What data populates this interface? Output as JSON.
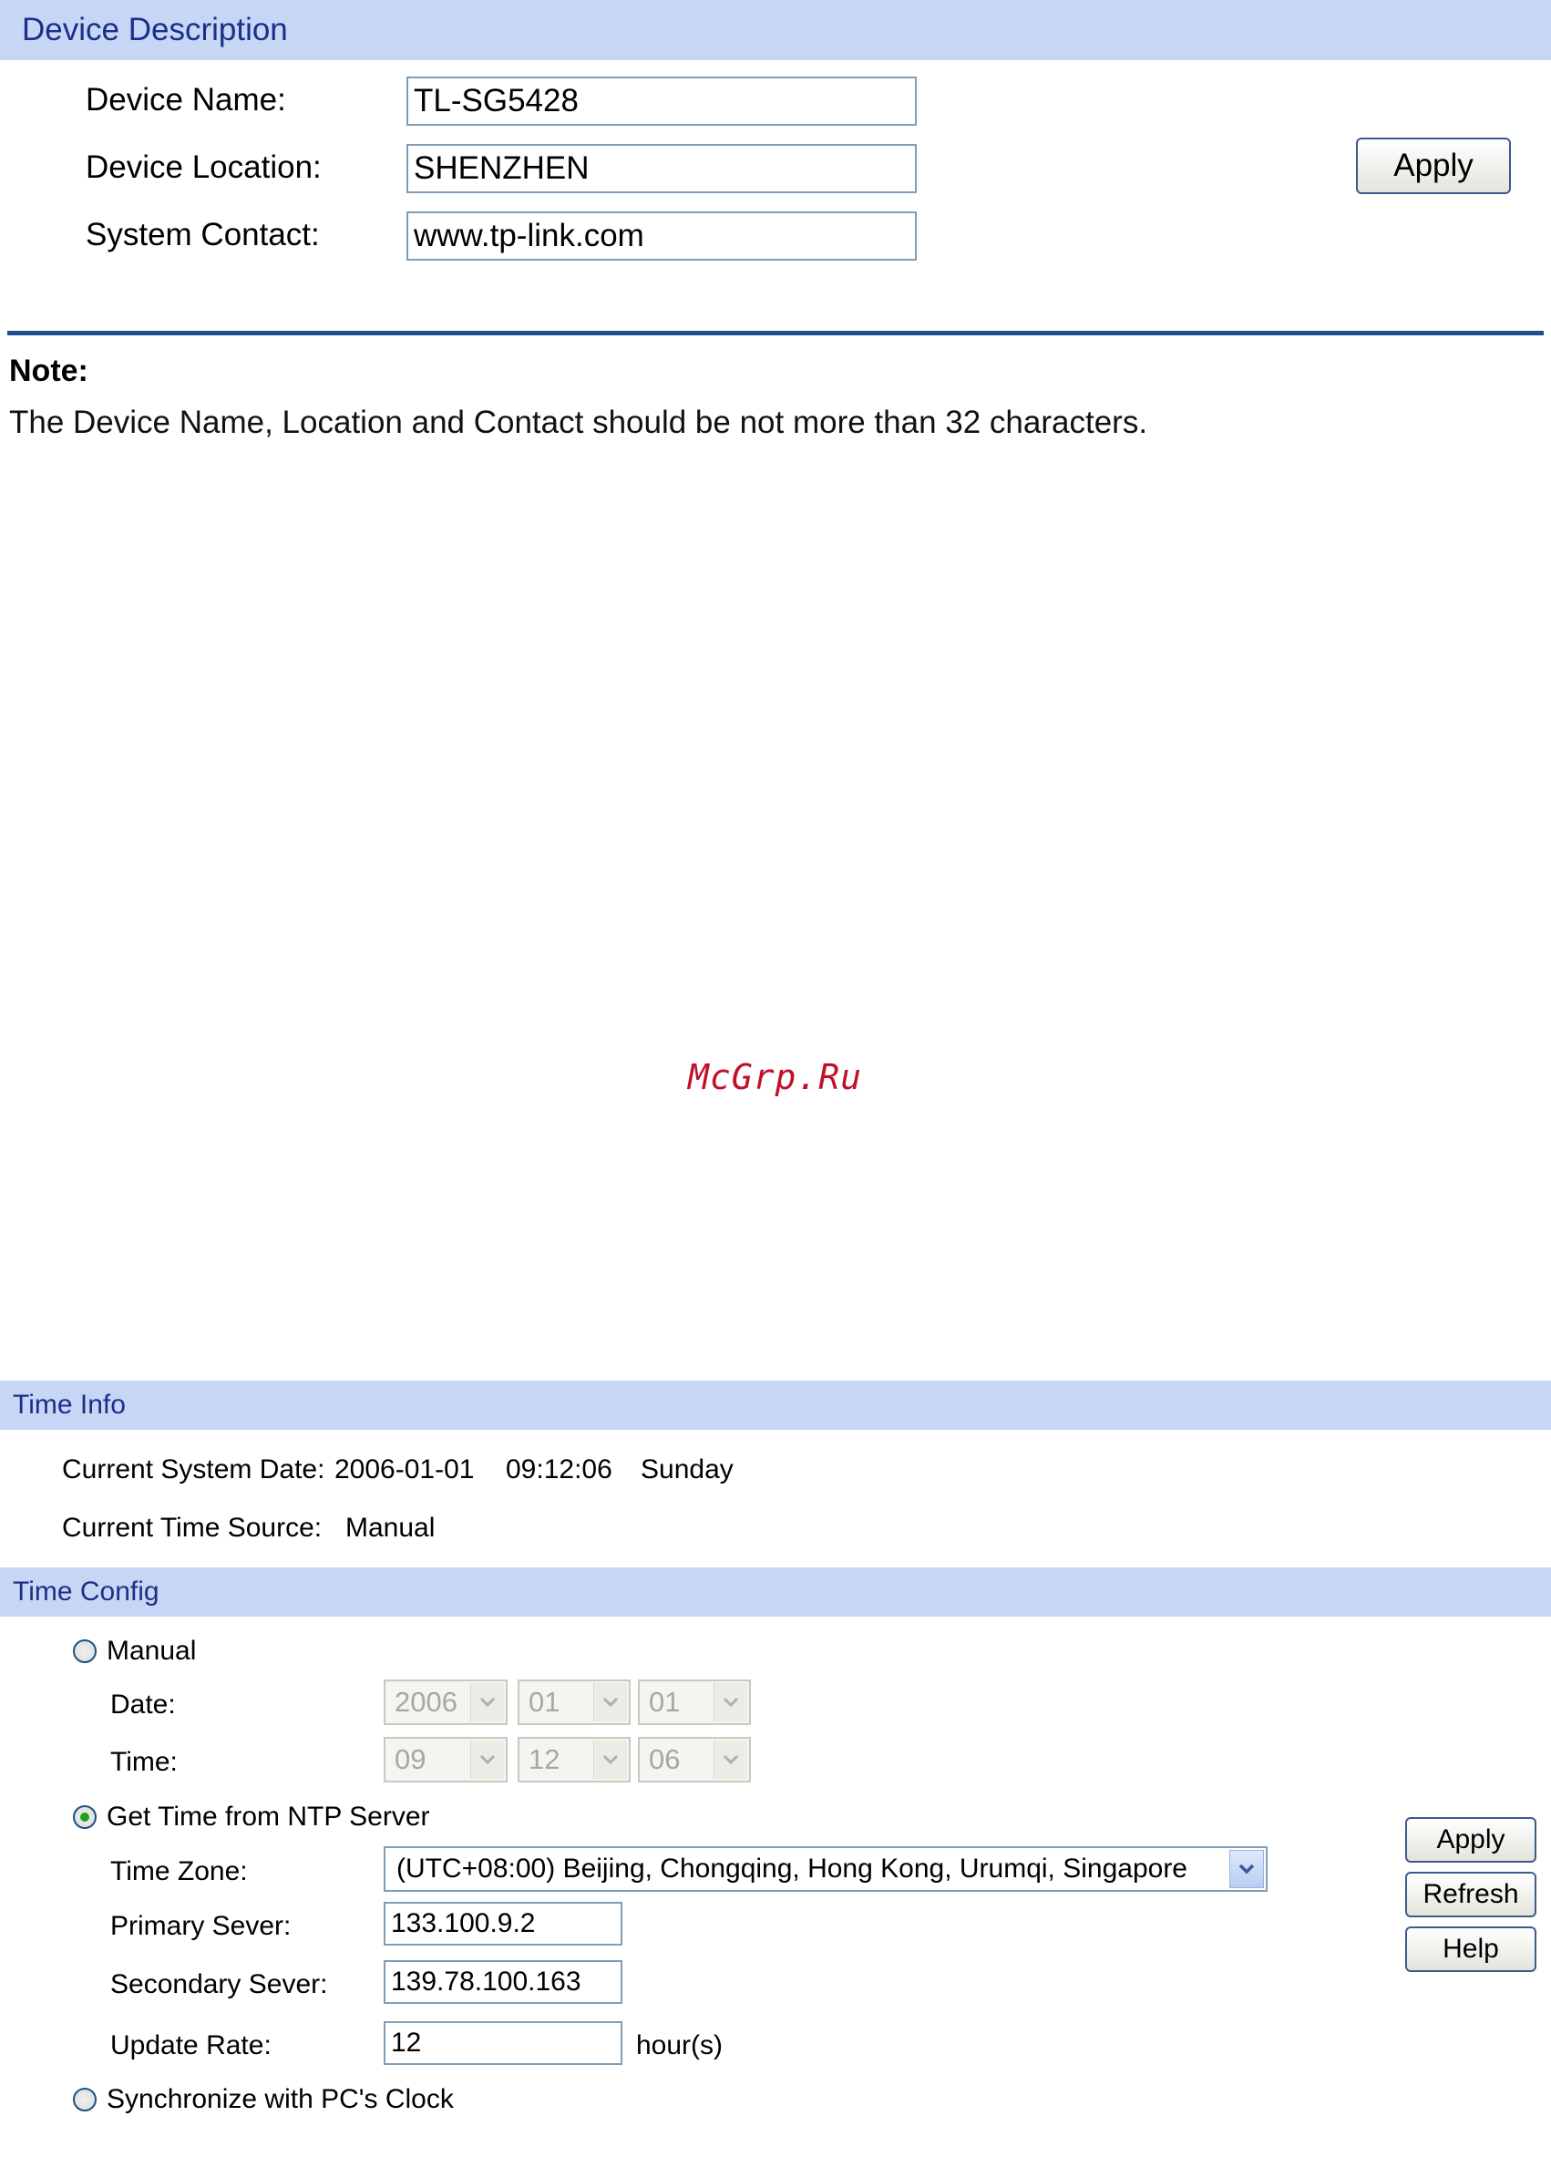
{
  "device_description": {
    "header": "Device Description",
    "device_name_label": "Device Name:",
    "device_name_value": "TL-SG5428",
    "device_location_label": "Device Location:",
    "device_location_value": "SHENZHEN",
    "system_contact_label": "System Contact:",
    "system_contact_value": "www.tp-link.com",
    "apply_label": "Apply"
  },
  "note": {
    "title": "Note:",
    "text": "The Device Name, Location and Contact should be not more than 32 characters."
  },
  "watermark": "McGrp.Ru",
  "time_info": {
    "header": "Time Info",
    "current_date_label": "Current System Date:",
    "current_date_value": "2006-01-01",
    "current_time_value": "09:12:06",
    "current_day_value": "Sunday",
    "time_source_label": "Current Time Source:",
    "time_source_value": "Manual"
  },
  "time_config": {
    "header": "Time Config",
    "manual_label": "Manual",
    "manual_selected": false,
    "date_label": "Date:",
    "date_year": "2006",
    "date_month": "01",
    "date_day": "01",
    "time_label": "Time:",
    "time_hour": "09",
    "time_minute": "12",
    "time_second": "06",
    "ntp_label": "Get Time from NTP Server",
    "ntp_selected": true,
    "time_zone_label": "Time Zone:",
    "time_zone_value": "(UTC+08:00) Beijing, Chongqing, Hong Kong, Urumqi, Singapore",
    "primary_server_label": "Primary Sever:",
    "primary_server_value": "133.100.9.2",
    "secondary_server_label": "Secondary Sever:",
    "secondary_server_value": "139.78.100.163",
    "update_rate_label": "Update Rate:",
    "update_rate_value": "12",
    "update_rate_unit": "hour(s)",
    "sync_pc_label": "Synchronize with PC's Clock",
    "sync_pc_selected": false,
    "apply_label": "Apply",
    "refresh_label": "Refresh",
    "help_label": "Help"
  },
  "colors": {
    "section_bar": "#c8d6f5",
    "section_text": "#1a2f8a",
    "divider": "#1f4e8c",
    "watermark": "#c0102a"
  }
}
